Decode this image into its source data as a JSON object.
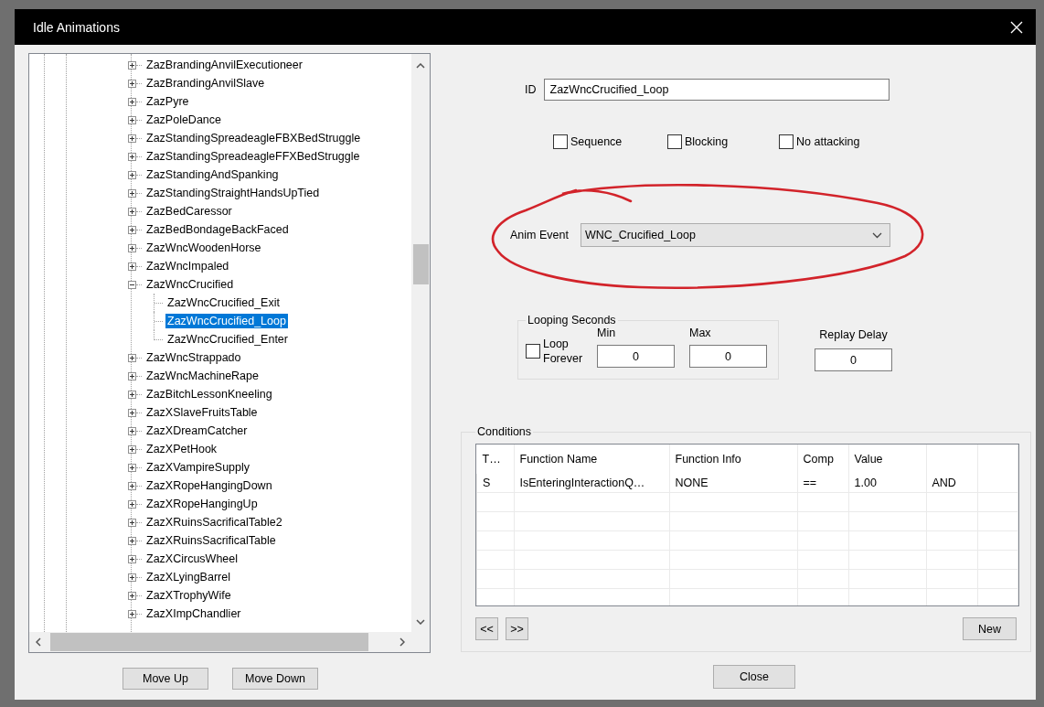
{
  "window": {
    "title": "Idle Animations"
  },
  "tree": {
    "items": [
      {
        "label": "ZazBrandingAnvilExecutioneer",
        "expanded": false,
        "selected": false
      },
      {
        "label": "ZazBrandingAnvilSlave",
        "expanded": false,
        "selected": false
      },
      {
        "label": "ZazPyre",
        "expanded": false,
        "selected": false
      },
      {
        "label": "ZazPoleDance",
        "expanded": false,
        "selected": false
      },
      {
        "label": "ZazStandingSpreadeagleFBXBedStruggle",
        "expanded": false,
        "selected": false
      },
      {
        "label": "ZazStandingSpreadeagleFFXBedStruggle",
        "expanded": false,
        "selected": false
      },
      {
        "label": "ZazStandingAndSpanking",
        "expanded": false,
        "selected": false
      },
      {
        "label": "ZazStandingStraightHandsUpTied",
        "expanded": false,
        "selected": false
      },
      {
        "label": "ZazBedCaressor",
        "expanded": false,
        "selected": false
      },
      {
        "label": "ZazBedBondageBackFaced",
        "expanded": false,
        "selected": false
      },
      {
        "label": "ZazWncWoodenHorse",
        "expanded": false,
        "selected": false
      },
      {
        "label": "ZazWncImpaled",
        "expanded": false,
        "selected": false
      },
      {
        "label": "ZazWncCrucified",
        "expanded": true,
        "selected": false,
        "children": [
          {
            "label": "ZazWncCrucified_Exit",
            "selected": false
          },
          {
            "label": "ZazWncCrucified_Loop",
            "selected": true
          },
          {
            "label": "ZazWncCrucified_Enter",
            "selected": false
          }
        ]
      },
      {
        "label": "ZazWncStrappado",
        "expanded": false,
        "selected": false
      },
      {
        "label": "ZazWncMachineRape",
        "expanded": false,
        "selected": false
      },
      {
        "label": "ZazBitchLessonKneeling",
        "expanded": false,
        "selected": false
      },
      {
        "label": "ZazXSlaveFruitsTable",
        "expanded": false,
        "selected": false
      },
      {
        "label": "ZazXDreamCatcher",
        "expanded": false,
        "selected": false
      },
      {
        "label": "ZazXPetHook",
        "expanded": false,
        "selected": false
      },
      {
        "label": "ZazXVampireSupply",
        "expanded": false,
        "selected": false
      },
      {
        "label": "ZazXRopeHangingDown",
        "expanded": false,
        "selected": false
      },
      {
        "label": "ZazXRopeHangingUp",
        "expanded": false,
        "selected": false
      },
      {
        "label": "ZazXRuinsSacrificalTable2",
        "expanded": false,
        "selected": false
      },
      {
        "label": "ZazXRuinsSacrificalTable",
        "expanded": false,
        "selected": false
      },
      {
        "label": "ZazXCircusWheel",
        "expanded": false,
        "selected": false
      },
      {
        "label": "ZazXLyingBarrel",
        "expanded": false,
        "selected": false
      },
      {
        "label": "ZazXTrophyWife",
        "expanded": false,
        "selected": false
      },
      {
        "label": "ZazXImpChandlier",
        "expanded": false,
        "selected": false
      }
    ]
  },
  "tree_buttons": [
    "Move Up",
    "Move Down"
  ],
  "id_field": {
    "label": "ID",
    "value": "ZazWncCrucified_Loop"
  },
  "checkboxes": [
    {
      "label": "Sequence",
      "checked": false
    },
    {
      "label": "Blocking",
      "checked": false
    },
    {
      "label": "No attacking",
      "checked": false
    }
  ],
  "anim_event": {
    "label": "Anim Event",
    "value": "WNC_Crucified_Loop"
  },
  "looping_seconds": {
    "title": "Looping Seconds",
    "loop_forever": {
      "label": "Loop Forever",
      "checked": false
    },
    "fields": [
      {
        "label": "Min",
        "value": "0"
      },
      {
        "label": "Max",
        "value": "0"
      }
    ]
  },
  "replay_delay": {
    "label": "Replay Delay",
    "value": "0"
  },
  "conditions": {
    "title": "Conditions",
    "columns": [
      "T…",
      "Function Name",
      "Function Info",
      "Comp",
      "Value"
    ],
    "rows": [
      [
        "S",
        "IsEnteringInteractionQ…",
        "NONE",
        "==",
        "1.00",
        "AND"
      ]
    ],
    "nav_buttons": [
      "<<",
      ">>"
    ],
    "new_button": "New"
  },
  "close_button": "Close"
}
